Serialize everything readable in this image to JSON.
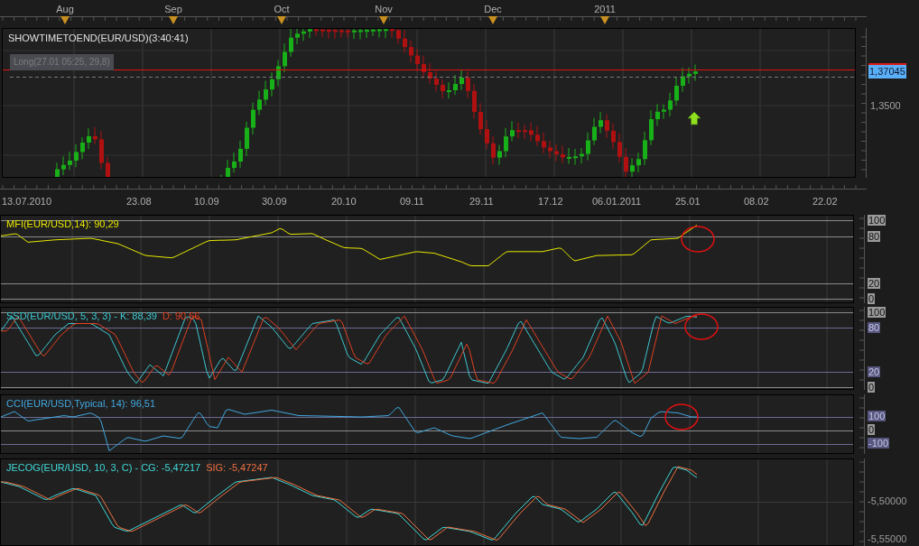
{
  "top_axis": {
    "months": [
      {
        "label": "Aug"
      },
      {
        "label": "Sep"
      },
      {
        "label": "Oct"
      },
      {
        "label": "Nov"
      },
      {
        "label": "Dec"
      },
      {
        "label": "2011"
      }
    ]
  },
  "main_chart": {
    "title": "SHOWTIMETOEND(EUR/USD)(3:40:41)",
    "position_badge": "Long(27.01 05:25, 29,8)",
    "price_labels": [
      {
        "label": "1,37045",
        "kind": "current"
      },
      {
        "label": "1,3500",
        "kind": "tick"
      }
    ]
  },
  "date_axis": [
    {
      "label": "13.07.2010"
    },
    {
      "label": "23.08"
    },
    {
      "label": "10.09"
    },
    {
      "label": "30.09"
    },
    {
      "label": "20.10"
    },
    {
      "label": "09.11"
    },
    {
      "label": "29.11"
    },
    {
      "label": "17.12"
    },
    {
      "label": "06.01.2011"
    },
    {
      "label": "25.01"
    },
    {
      "label": "08.02"
    },
    {
      "label": "22.02"
    }
  ],
  "indicators": [
    {
      "kind": "mfi",
      "legend": [
        {
          "text": "MFI(EUR/USD,14): 90,29",
          "color": "#e8e800"
        }
      ],
      "levels": [
        {
          "label": "100",
          "kind": "plain"
        },
        {
          "label": "80",
          "kind": "plain"
        },
        {
          "label": "20",
          "kind": "plain"
        },
        {
          "label": "0",
          "kind": "plain"
        }
      ]
    },
    {
      "kind": "ssd",
      "legend": [
        {
          "text": "SSD(EUR/USD, 5, 3, 3) -  K: 88,39",
          "color": "#3cc8d0"
        },
        {
          "text": "D: 90,66",
          "color": "#e04020"
        }
      ],
      "levels": [
        {
          "label": "100",
          "kind": "plain"
        },
        {
          "label": "80",
          "kind": "accent"
        },
        {
          "label": "20",
          "kind": "accent"
        },
        {
          "label": "0",
          "kind": "plain"
        }
      ]
    },
    {
      "kind": "cci",
      "legend": [
        {
          "text": "CCI(EUR/USD,Typical, 14): 96,51",
          "color": "#40a8e0"
        }
      ],
      "levels": [
        {
          "label": "100",
          "kind": "accent"
        },
        {
          "label": "0",
          "kind": "plain"
        },
        {
          "label": "-100",
          "kind": "accent"
        }
      ]
    },
    {
      "kind": "jecog",
      "legend": [
        {
          "text": "JECOG(EUR/USD, 10, 3, C) -  CG: -5,47217",
          "color": "#40d8d8"
        },
        {
          "text": "SIG: -5,47247",
          "color": "#f07040"
        }
      ],
      "levels": [
        {
          "label": "-5,50000",
          "kind": "tick"
        },
        {
          "label": "-5,55000",
          "kind": "tick"
        }
      ]
    }
  ]
}
